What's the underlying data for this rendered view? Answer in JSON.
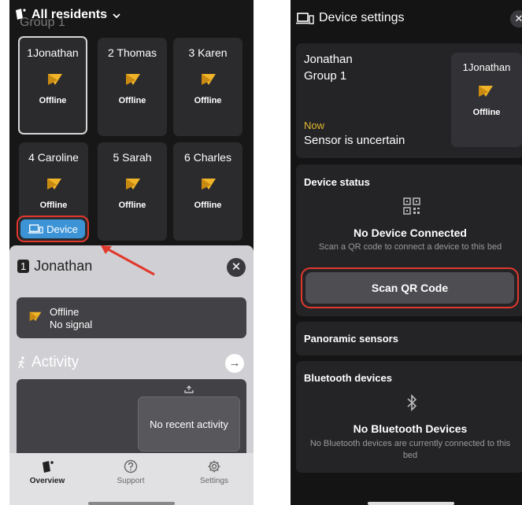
{
  "left": {
    "header": {
      "title": "All residents",
      "dropdown_icon": "chevron-down-icon"
    },
    "group_label": "Group 1",
    "tiles": [
      {
        "num": "1",
        "name": "Jonathan",
        "status": "Offline"
      },
      {
        "num": "2",
        "name": "Thomas",
        "status": "Offline"
      },
      {
        "num": "3",
        "name": "Karen",
        "status": "Offline"
      },
      {
        "num": "4",
        "name": "Caroline",
        "status": "Offline"
      },
      {
        "num": "5",
        "name": "Sarah",
        "status": "Offline"
      },
      {
        "num": "6",
        "name": "Charles",
        "status": "Offline"
      }
    ],
    "device_button": {
      "label": "Device",
      "icon": "device-icon"
    },
    "sheet": {
      "num": "1",
      "name": "Jonathan",
      "status_line1": "Offline",
      "status_line2": "No signal",
      "activity_title": "Activity",
      "no_recent": "No recent activity"
    },
    "tabs": [
      {
        "label": "Overview",
        "icon": "overview-icon",
        "active": true
      },
      {
        "label": "Support",
        "icon": "support-icon",
        "active": false
      },
      {
        "label": "Settings",
        "icon": "gear-icon",
        "active": false
      }
    ]
  },
  "right": {
    "header": {
      "title": "Device settings",
      "close_icon": "close-icon"
    },
    "person": {
      "name": "Jonathan",
      "group": "Group 1",
      "time": "Now",
      "sensor_status": "Sensor is uncertain",
      "tile": {
        "num": "1",
        "name": "Jonathan",
        "status": "Offline"
      }
    },
    "device_status": {
      "title": "Device status",
      "no_device": "No Device Connected",
      "hint": "Scan a QR code to connect a device to this bed",
      "scan_button": "Scan QR Code"
    },
    "panoramic": {
      "title": "Panoramic sensors"
    },
    "bluetooth": {
      "title": "Bluetooth devices",
      "no_devices": "No Bluetooth Devices",
      "hint": "No Bluetooth devices are currently connected to this bed"
    }
  },
  "colors": {
    "accent_blue": "#3c94d6",
    "highlight_red": "#e2382c",
    "offline_icon_yellow": "#f0b429",
    "now_yellow": "#e2b82e"
  }
}
